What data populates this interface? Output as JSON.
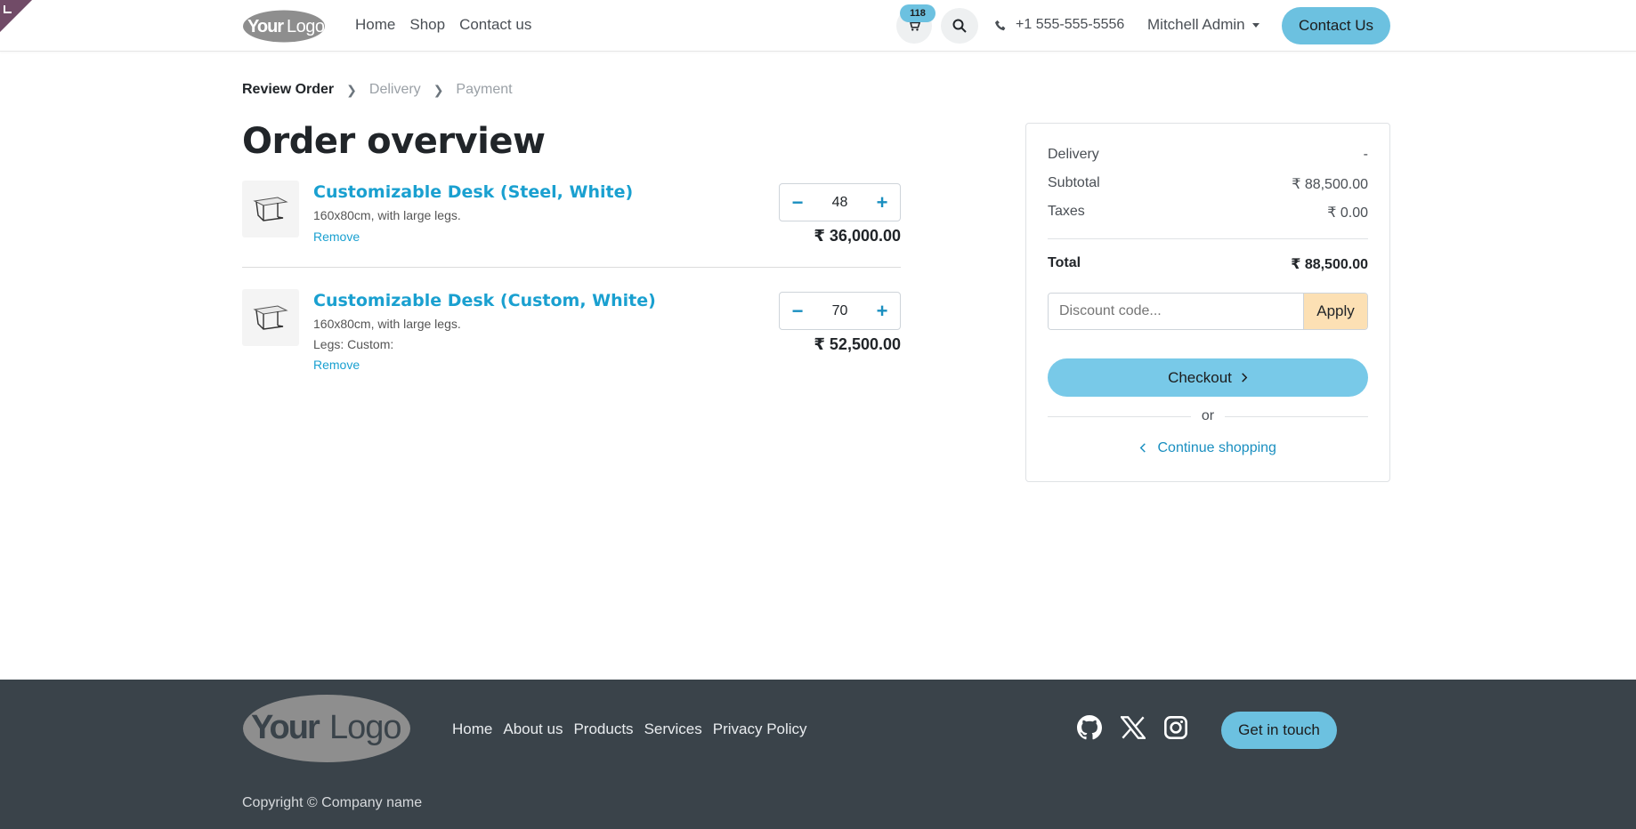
{
  "header": {
    "logo_text": "YourLogo",
    "nav": [
      "Home",
      "Shop",
      "Contact us"
    ],
    "cart_count": "118",
    "phone": "+1 555-555-5556",
    "user": "Mitchell Admin",
    "contact_button": "Contact Us"
  },
  "breadcrumb": {
    "steps": [
      "Review Order",
      "Delivery",
      "Payment"
    ]
  },
  "page_title": "Order overview",
  "order_lines": [
    {
      "name": "Customizable Desk (Steel, White)",
      "description": "160x80cm, with large legs.",
      "extra": "",
      "remove": "Remove",
      "quantity": "48",
      "price": "₹ 36,000.00"
    },
    {
      "name": "Customizable Desk (Custom, White)",
      "description": "160x80cm, with large legs.",
      "extra": "Legs: Custom:",
      "remove": "Remove",
      "quantity": "70",
      "price": "₹ 52,500.00"
    }
  ],
  "summary": {
    "delivery_label": "Delivery",
    "delivery_value": "-",
    "subtotal_label": "Subtotal",
    "subtotal_value": "₹ 88,500.00",
    "taxes_label": "Taxes",
    "taxes_value": "₹ 0.00",
    "total_label": "Total",
    "total_value": "₹ 88,500.00",
    "discount_placeholder": "Discount code...",
    "apply_label": "Apply",
    "checkout_label": "Checkout",
    "or_label": "or",
    "continue_label": "Continue shopping"
  },
  "footer": {
    "logo_text": "YourLogo",
    "nav": [
      "Home",
      "About us",
      "Products",
      "Services",
      "Privacy Policy"
    ],
    "social_icons": [
      "github-icon",
      "x-twitter-icon",
      "instagram-icon"
    ],
    "cta": "Get in touch",
    "copyright": "Copyright © Company name"
  },
  "colors": {
    "accent": "#6cc1e0",
    "link": "#1aa0d0",
    "footer_bg": "#3a434a",
    "apply_bg": "#fce0b4",
    "corner": "#714B67"
  }
}
